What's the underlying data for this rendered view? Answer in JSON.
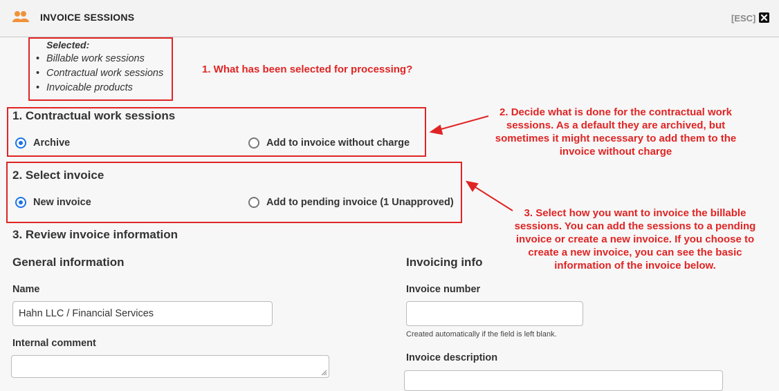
{
  "header": {
    "title": "INVOICE SESSIONS",
    "esc_label": "[ESC]",
    "app_icon": "users-icon",
    "close_icon": "close-icon"
  },
  "selected": {
    "title": "Selected:",
    "items": [
      "Billable work sessions",
      "Contractual work sessions",
      "Invoicable products"
    ]
  },
  "section1": {
    "title": "1. Contractual work sessions",
    "options": [
      {
        "label": "Archive",
        "checked": true
      },
      {
        "label": "Add to invoice without charge",
        "checked": false
      }
    ]
  },
  "section2": {
    "title": "2. Select invoice",
    "options": [
      {
        "label": "New invoice",
        "checked": true
      },
      {
        "label": "Add to pending invoice (1 Unapproved)",
        "checked": false
      }
    ]
  },
  "section3": {
    "title": "3. Review invoice information",
    "general": {
      "title": "General information",
      "name_label": "Name",
      "name_value": "Hahn LLC / Financial Services",
      "comment_label": "Internal comment",
      "comment_value": ""
    },
    "invoicing": {
      "title": "Invoicing info",
      "number_label": "Invoice number",
      "number_value": "",
      "number_hint": "Created automatically if the field is left blank.",
      "description_label": "Invoice description"
    }
  },
  "annotations": {
    "a1": "1. What has been selected for processing?",
    "a2_lines": [
      "2. Decide what is done for the contractual work",
      "sessions. As a default they are archived, but",
      "sometimes it might necessary to add them to the",
      "invoice without charge"
    ],
    "a3_lines": [
      "3. Select how you want to invoice the billable",
      "sessions. You can add the sessions to a pending",
      "invoice or create a new invoice. If you choose to",
      "create a new invoice, you can see the basic",
      "information of the invoice below."
    ]
  },
  "colors": {
    "annotation_red": "#e02424",
    "radio_blue": "#1a73e8",
    "app_icon_orange": "#f0923a"
  }
}
